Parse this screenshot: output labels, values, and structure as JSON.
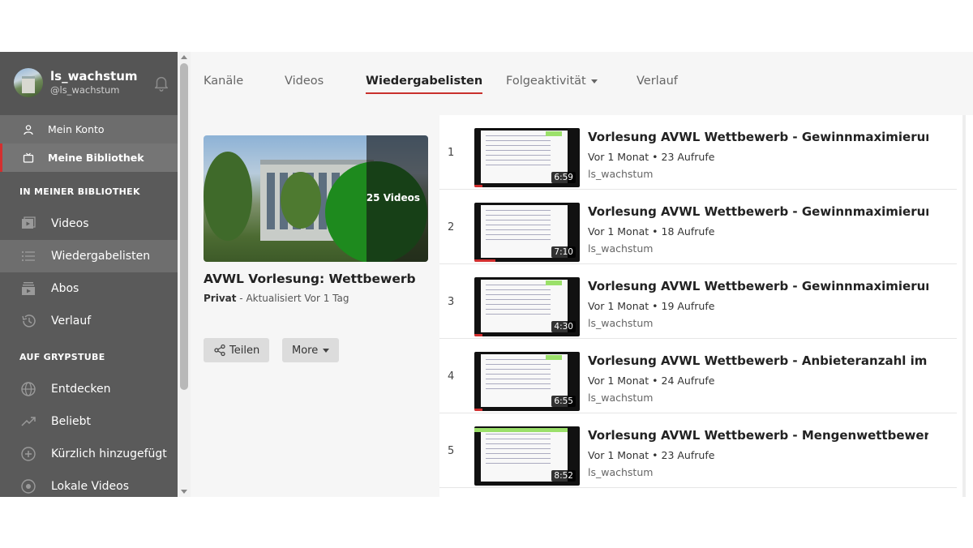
{
  "user": {
    "name": "ls_wachstum",
    "handle": "@ls_wachstum"
  },
  "account_nav": [
    {
      "label": "Mein Konto",
      "icon": "person-icon",
      "active": false
    },
    {
      "label": "Meine Bibliothek",
      "icon": "tv-icon",
      "active": true
    }
  ],
  "library_section": {
    "title": "IN MEINER BIBLIOTHEK",
    "items": [
      {
        "label": "Videos",
        "icon": "video-library-icon",
        "active": false
      },
      {
        "label": "Wiedergabelisten",
        "icon": "playlist-icon",
        "active": true
      },
      {
        "label": "Abos",
        "icon": "subscriptions-icon",
        "active": false
      },
      {
        "label": "Verlauf",
        "icon": "history-icon",
        "active": false
      }
    ]
  },
  "platform_section": {
    "title": "AUF GRYPSTUBE",
    "items": [
      {
        "label": "Entdecken",
        "icon": "globe-icon"
      },
      {
        "label": "Beliebt",
        "icon": "trending-icon"
      },
      {
        "label": "Kürzlich hinzugefügt",
        "icon": "plus-circle-icon"
      },
      {
        "label": "Lokale Videos",
        "icon": "local-icon"
      }
    ]
  },
  "tabs": [
    {
      "label": "Kanäle",
      "active": false
    },
    {
      "label": "Videos",
      "active": false
    },
    {
      "label": "Wiedergabelisten",
      "active": true
    },
    {
      "label": "Folgeaktivität",
      "active": false,
      "dropdown": true
    },
    {
      "label": "Verlauf",
      "active": false
    }
  ],
  "playlist": {
    "title": "AVWL Vorlesung: Wettbewerb",
    "video_count": "25 Videos",
    "privacy": "Privat",
    "updated": " - Aktualisiert Vor 1 Tag",
    "share_label": "Teilen",
    "more_label": "More"
  },
  "videos": [
    {
      "index": "1",
      "title": "Vorlesung AVWL Wettbewerb - Gewinnmaximierung des",
      "meta": "Vor 1 Monat • 23 Aufrufe",
      "channel": "ls_wachstum",
      "duration": "6:59",
      "progress": 0.08
    },
    {
      "index": "2",
      "title": "Vorlesung AVWL Wettbewerb - Gewinnmaximierung des",
      "meta": "Vor 1 Monat • 18 Aufrufe",
      "channel": "ls_wachstum",
      "duration": "7:10",
      "progress": 0.2
    },
    {
      "index": "3",
      "title": "Vorlesung AVWL Wettbewerb - Gewinnmaximierung des",
      "meta": "Vor 1 Monat • 19 Aufrufe",
      "channel": "ls_wachstum",
      "duration": "4:30",
      "progress": 0.08
    },
    {
      "index": "4",
      "title": "Vorlesung AVWL Wettbewerb - Anbieteranzahl im Cournot",
      "meta": "Vor 1 Monat • 24 Aufrufe",
      "channel": "ls_wachstum",
      "duration": "6:55",
      "progress": 0.08
    },
    {
      "index": "5",
      "title": "Vorlesung AVWL Wettbewerb - Mengenwettbewerb nach",
      "meta": "Vor 1 Monat • 23 Aufrufe",
      "channel": "ls_wachstum",
      "duration": "8:52",
      "progress": 0.0
    }
  ],
  "colors": {
    "accent": "#d32f2f",
    "sidebar_bg": "#5a5a5a",
    "highlight_green": "#1e8a1e"
  }
}
